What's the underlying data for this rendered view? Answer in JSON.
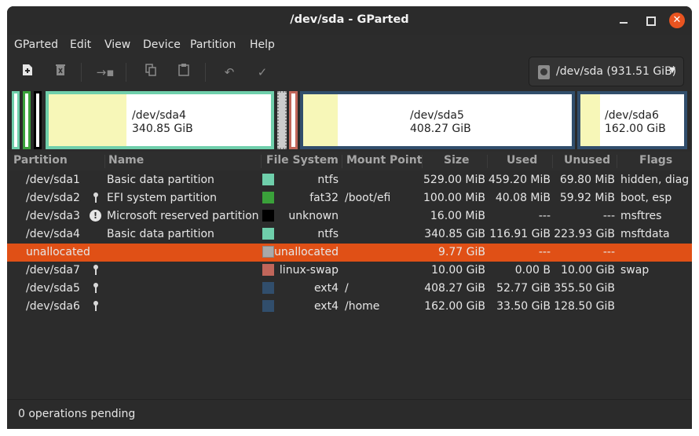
{
  "window": {
    "title": "/dev/sda - GParted"
  },
  "menu": [
    "GParted",
    "Edit",
    "View",
    "Device",
    "Partition",
    "Help"
  ],
  "toolbar": {
    "icons": [
      "new-partition",
      "delete-partition",
      "resize-move",
      "copy",
      "paste",
      "undo",
      "apply"
    ]
  },
  "device_selector": {
    "label": "/dev/sda (931.51 GiB)"
  },
  "disk_map": {
    "sda4": {
      "name": "/dev/sda4",
      "size": "340.85 GiB"
    },
    "sda5": {
      "name": "/dev/sda5",
      "size": "408.27 GiB"
    },
    "sda6": {
      "name": "/dev/sda6",
      "size": "162.00 GiB"
    }
  },
  "columns": [
    "Partition",
    "Name",
    "File System",
    "Mount Point",
    "Size",
    "Used",
    "Unused",
    "Flags"
  ],
  "rows": [
    {
      "partition": "/dev/sda1",
      "name": "Basic data partition",
      "fs": "ntfs",
      "mount": "",
      "size": "529.00 MiB",
      "used": "459.20 MiB",
      "unused": "69.80 MiB",
      "flags": "hidden, diag",
      "color": "#6fcfab",
      "badge": ""
    },
    {
      "partition": "/dev/sda2",
      "name": "EFI system partition",
      "fs": "fat32",
      "mount": "/boot/efi",
      "size": "100.00 MiB",
      "used": "40.08 MiB",
      "unused": "59.92 MiB",
      "flags": "boot, esp",
      "color": "#3aa13a",
      "badge": "key"
    },
    {
      "partition": "/dev/sda3",
      "name": "Microsoft reserved partition",
      "fs": "unknown",
      "mount": "",
      "size": "16.00 MiB",
      "used": "---",
      "unused": "---",
      "flags": "msftres",
      "color": "#000000",
      "badge": "warn"
    },
    {
      "partition": "/dev/sda4",
      "name": "Basic data partition",
      "fs": "ntfs",
      "mount": "",
      "size": "340.85 GiB",
      "used": "116.91 GiB",
      "unused": "223.93 GiB",
      "flags": "msftdata",
      "color": "#6fcfab",
      "badge": ""
    },
    {
      "partition": "unallocated",
      "name": "",
      "fs": "unallocated",
      "mount": "",
      "size": "9.77 GiB",
      "used": "---",
      "unused": "---",
      "flags": "",
      "color": "#a9a9a9",
      "badge": "",
      "selected": true
    },
    {
      "partition": "/dev/sda7",
      "name": "",
      "fs": "linux-swap",
      "mount": "",
      "size": "10.00 GiB",
      "used": "0.00 B",
      "unused": "10.00 GiB",
      "flags": "swap",
      "color": "#c1665a",
      "badge": "key"
    },
    {
      "partition": "/dev/sda5",
      "name": "",
      "fs": "ext4",
      "mount": "/",
      "size": "408.27 GiB",
      "used": "52.77 GiB",
      "unused": "355.50 GiB",
      "flags": "",
      "color": "#314e6c",
      "badge": "key"
    },
    {
      "partition": "/dev/sda6",
      "name": "",
      "fs": "ext4",
      "mount": "/home",
      "size": "162.00 GiB",
      "used": "33.50 GiB",
      "unused": "128.50 GiB",
      "flags": "",
      "color": "#314e6c",
      "badge": "key"
    }
  ],
  "status": {
    "text": "0 operations pending"
  },
  "colors": {
    "accent": "#e05016",
    "ntfs": "#6fcfab",
    "fat32": "#3aa13a",
    "swap": "#c1665a",
    "ext4": "#314e6c"
  }
}
